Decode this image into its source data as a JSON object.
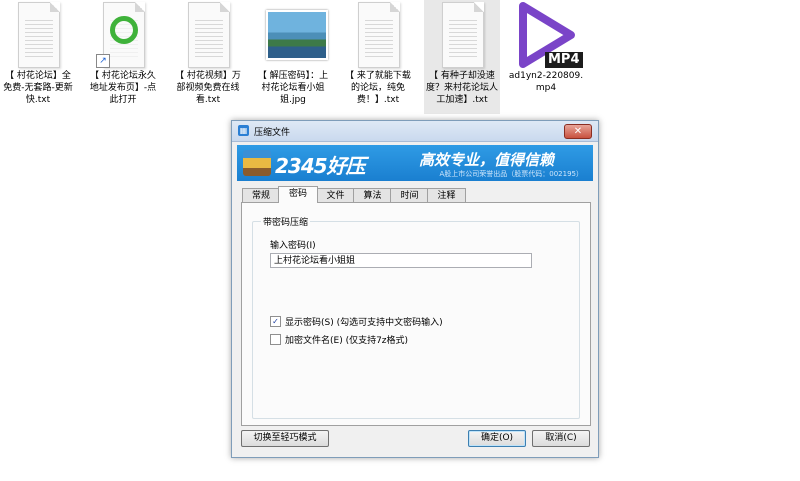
{
  "desktop": {
    "icons": [
      {
        "label": "【 村花论坛】全免费-无套路-更新快.txt"
      },
      {
        "label": "【 村花论坛永久地址发布页】-点此打开"
      },
      {
        "label": "【 村花视频】万部视频免费在线看.txt"
      },
      {
        "label": "【 解压密码】：上村花论坛看小姐姐.jpg"
      },
      {
        "label": "【 来了就能下载的论坛，纯免费！】.txt"
      },
      {
        "label": "【 有种子却没速度？来村花论坛人工加速】.txt"
      },
      {
        "label": "ad1yn2-220809.mp4",
        "badge": "MP4"
      }
    ]
  },
  "dialog": {
    "title": "压缩文件",
    "close_glyph": "✕",
    "banner": {
      "brand": "2345好压",
      "slogan": "高效专业，值得信赖",
      "sub": "A股上市公司荣誉出品（股票代码：002195）"
    },
    "tabs": [
      "常规",
      "密码",
      "文件",
      "算法",
      "时间",
      "注释"
    ],
    "active_tab": "密码",
    "group_title": "带密码压缩",
    "password_label": "输入密码(I)",
    "password_value": "上村花论坛看小姐姐",
    "show_password": {
      "label": "显示密码(S)  (勾选可支持中文密码输入)",
      "checked": true,
      "mark": "✓"
    },
    "encrypt_names": {
      "label": "加密文件名(E)  (仅支持7z格式)",
      "checked": false
    },
    "buttons": {
      "mode_switch": "切换至轻巧模式",
      "ok": "确定(O)",
      "cancel": "取消(C)"
    }
  },
  "colors": {
    "banner": "#1a7fd0",
    "mp4_play": "#7a44c8"
  }
}
